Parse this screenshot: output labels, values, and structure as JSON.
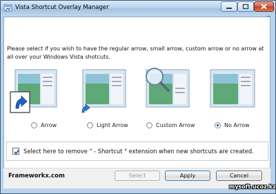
{
  "window": {
    "title": "Vista Shortcut Overlay Manager"
  },
  "intro": {
    "text": "Please select if you wish to have the regular arrow, small arrow, custom arrow or no arrow at all over your Windows Vista shotcuts."
  },
  "options": [
    {
      "label": "Arrow",
      "selected": false
    },
    {
      "label": "Light Arrow",
      "selected": false
    },
    {
      "label": "Custom Arrow",
      "selected": false
    },
    {
      "label": "No Arrow",
      "selected": true
    }
  ],
  "checkbox": {
    "label": "Select here to remove \" - Shortcut \" extension when new shortcuts are created.",
    "checked": true
  },
  "footer": {
    "brand": "Frameworkx.com"
  },
  "buttons": {
    "select": "Select",
    "apply": "Apply",
    "cancel": "Cancel"
  },
  "watermark": "mysoft.ucoz.kz",
  "colors": {
    "accent": "#1b4c8a",
    "close": "#c23d1e",
    "frame": "#b9d3ea"
  }
}
